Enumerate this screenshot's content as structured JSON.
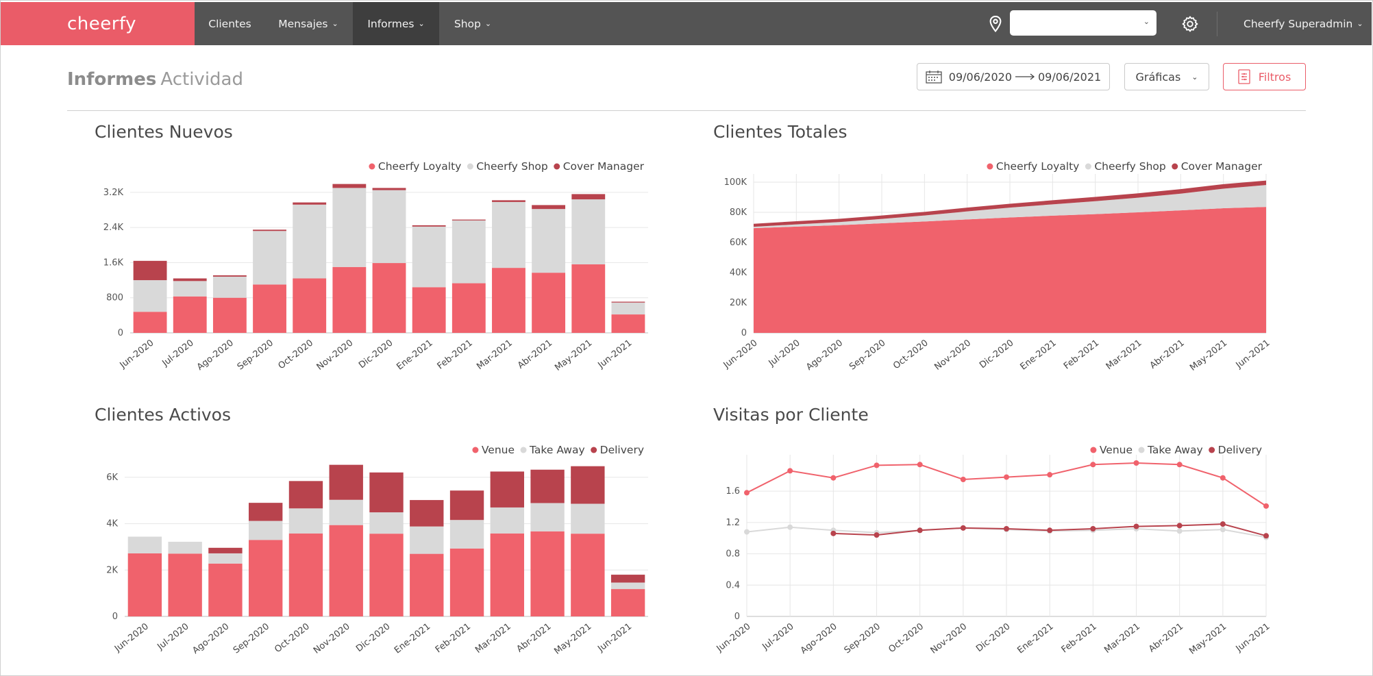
{
  "app": {
    "logo": "cheerfy",
    "nav": [
      {
        "label": "Clientes",
        "dropdown": false
      },
      {
        "label": "Mensajes",
        "dropdown": true
      },
      {
        "label": "Informes",
        "dropdown": true,
        "active": true
      },
      {
        "label": "Shop",
        "dropdown": true
      }
    ],
    "location_select_value": "",
    "user_menu": "Cheerfy Superadmin",
    "icons": {
      "location": "map-pin-icon",
      "settings": "gear-icon",
      "calendar": "calendar-icon",
      "filters": "filter-icon"
    }
  },
  "page": {
    "title": "Informes",
    "subtitle": "Actividad",
    "date_from": "09/06/2020",
    "date_to": "09/06/2021",
    "graph_select": "Gráficas",
    "filters_button": "Filtros"
  },
  "colors": {
    "accent": "#ea5c68",
    "series1": "#f0626c",
    "series2": "#d9d9d9",
    "series3": "#b8434d",
    "nav_bg": "#545454"
  },
  "chart_data": [
    {
      "id": "nuevos",
      "title": "Clientes Nuevos",
      "type": "bar",
      "stacked": true,
      "categories": [
        "Jun-2020",
        "Jul-2020",
        "Ago-2020",
        "Sep-2020",
        "Oct-2020",
        "Nov-2020",
        "Dic-2020",
        "Ene-2021",
        "Feb-2021",
        "Mar-2021",
        "Abr-2021",
        "May-2021",
        "Jun-2021"
      ],
      "series": [
        {
          "name": "Cheerfy Loyalty",
          "values": [
            480,
            830,
            800,
            1100,
            1240,
            1500,
            1590,
            1040,
            1130,
            1480,
            1370,
            1560,
            420
          ]
        },
        {
          "name": "Cheerfy Shop",
          "values": [
            720,
            350,
            480,
            1220,
            1680,
            1800,
            1660,
            1380,
            1430,
            1500,
            1450,
            1480,
            270
          ]
        },
        {
          "name": "Cover Manager",
          "values": [
            440,
            60,
            30,
            30,
            50,
            90,
            50,
            30,
            20,
            40,
            90,
            120,
            20
          ]
        }
      ],
      "yticks": [
        "0",
        "800",
        "1.6K",
        "2.4K",
        "3.2K"
      ],
      "ylim": [
        0,
        3400
      ],
      "legend": "top-right"
    },
    {
      "id": "totales",
      "title": "Clientes Totales",
      "type": "area",
      "stacked": true,
      "categories": [
        "Jun-2020",
        "Jul-2020",
        "Ago-2020",
        "Sep-2020",
        "Oct-2020",
        "Nov-2020",
        "Dic-2020",
        "Ene-2021",
        "Feb-2021",
        "Mar-2021",
        "Abr-2021",
        "May-2021",
        "Jun-2021"
      ],
      "series": [
        {
          "name": "Cheerfy Loyalty",
          "values": [
            69500,
            70500,
            71500,
            72700,
            73900,
            75300,
            76600,
            77800,
            78800,
            80000,
            81300,
            82700,
            83600
          ]
        },
        {
          "name": "Cheerfy Shop",
          "values": [
            900,
            1500,
            2000,
            2900,
            4000,
            5300,
            6500,
            7500,
            8600,
            9700,
            11100,
            13000,
            14500
          ]
        },
        {
          "name": "Cover Manager",
          "values": [
            2000,
            2100,
            2200,
            2300,
            2400,
            2500,
            2600,
            2700,
            2800,
            2900,
            3000,
            3000,
            3000
          ]
        }
      ],
      "yticks": [
        "0",
        "20K",
        "40K",
        "60K",
        "80K",
        "100K"
      ],
      "ylim": [
        0,
        100000
      ],
      "legend": "top-right"
    },
    {
      "id": "activos",
      "title": "Clientes Activos",
      "type": "bar",
      "stacked": true,
      "categories": [
        "Jun-2020",
        "Jul-2020",
        "Ago-2020",
        "Sep-2020",
        "Oct-2020",
        "Nov-2020",
        "Dic-2020",
        "Ene-2021",
        "Feb-2021",
        "Mar-2021",
        "Abr-2021",
        "May-2021",
        "Jun-2021"
      ],
      "series": [
        {
          "name": "Venue",
          "values": [
            2720,
            2710,
            2280,
            3300,
            3580,
            3940,
            3570,
            2700,
            2930,
            3580,
            3670,
            3570,
            1180
          ]
        },
        {
          "name": "Take Away",
          "values": [
            720,
            510,
            440,
            820,
            1080,
            1090,
            920,
            1180,
            1230,
            1120,
            1220,
            1290,
            280
          ]
        },
        {
          "name": "Delivery",
          "values": [
            0,
            0,
            240,
            780,
            1180,
            1510,
            1720,
            1140,
            1270,
            1550,
            1440,
            1620,
            340
          ]
        }
      ],
      "yticks": [
        "0",
        "2K",
        "4K",
        "6K"
      ],
      "ylim": [
        0,
        6500
      ],
      "legend": "top-right"
    },
    {
      "id": "visitas",
      "title": "Visitas por Cliente",
      "type": "line",
      "categories": [
        "Jun-2020",
        "Jul-2020",
        "Ago-2020",
        "Sep-2020",
        "Oct-2020",
        "Nov-2020",
        "Dic-2020",
        "Ene-2021",
        "Feb-2021",
        "Mar-2021",
        "Abr-2021",
        "May-2021",
        "Jun-2021"
      ],
      "series": [
        {
          "name": "Venue",
          "values": [
            1.58,
            1.86,
            1.77,
            1.93,
            1.94,
            1.75,
            1.78,
            1.81,
            1.94,
            1.96,
            1.94,
            1.77,
            1.41
          ]
        },
        {
          "name": "Take Away",
          "values": [
            1.08,
            1.14,
            1.1,
            1.07,
            1.1,
            1.13,
            1.11,
            1.09,
            1.1,
            1.12,
            1.09,
            1.11,
            1.01
          ]
        },
        {
          "name": "Delivery",
          "values": [
            null,
            null,
            1.06,
            1.04,
            1.1,
            1.13,
            1.12,
            1.1,
            1.12,
            1.15,
            1.16,
            1.18,
            1.03
          ]
        }
      ],
      "yticks": [
        "0",
        "0.4",
        "0.8",
        "1.2",
        "1.6"
      ],
      "ylim": [
        0,
        1.96
      ],
      "legend": "top-right"
    }
  ]
}
